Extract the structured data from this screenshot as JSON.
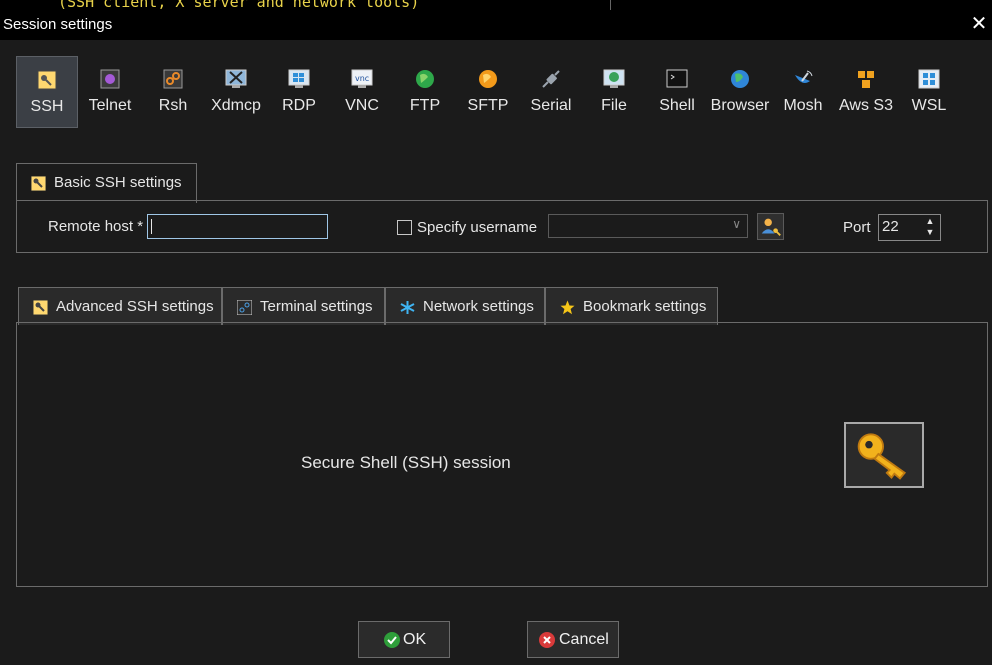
{
  "background": {
    "terminal_text": "(SSH client, X server and network tools)"
  },
  "window": {
    "title": "Session settings",
    "close_glyph": "✕"
  },
  "session_types": [
    {
      "label": "SSH",
      "icon": "ssh-key-icon"
    },
    {
      "label": "Telnet",
      "icon": "telnet-icon"
    },
    {
      "label": "Rsh",
      "icon": "rsh-icon"
    },
    {
      "label": "Xdmcp",
      "icon": "xdmcp-icon"
    },
    {
      "label": "RDP",
      "icon": "rdp-icon"
    },
    {
      "label": "VNC",
      "icon": "vnc-icon"
    },
    {
      "label": "FTP",
      "icon": "ftp-globe-icon"
    },
    {
      "label": "SFTP",
      "icon": "sftp-globe-icon"
    },
    {
      "label": "Serial",
      "icon": "serial-plug-icon"
    },
    {
      "label": "File",
      "icon": "file-monitor-icon"
    },
    {
      "label": "Shell",
      "icon": "shell-terminal-icon"
    },
    {
      "label": "Browser",
      "icon": "browser-globe-icon"
    },
    {
      "label": "Mosh",
      "icon": "mosh-satellite-icon"
    },
    {
      "label": "Aws S3",
      "icon": "aws-s3-cubes-icon"
    },
    {
      "label": "WSL",
      "icon": "wsl-windows-icon"
    }
  ],
  "basic": {
    "tab_label": "Basic SSH settings",
    "remote_host_label": "Remote host *",
    "remote_host_value": "",
    "specify_username_label": "Specify username",
    "specify_username_checked": false,
    "username_value": "",
    "port_label": "Port",
    "port_value": "22"
  },
  "advanced_tabs": [
    {
      "label": "Advanced SSH settings",
      "icon": "ssh-key-icon"
    },
    {
      "label": "Terminal settings",
      "icon": "terminal-icon"
    },
    {
      "label": "Network settings",
      "icon": "network-icon"
    },
    {
      "label": "Bookmark settings",
      "icon": "star-icon"
    }
  ],
  "description": "Secure Shell (SSH) session",
  "buttons": {
    "ok": "OK",
    "cancel": "Cancel"
  },
  "colors": {
    "accent": "#e9a31f",
    "ok": "#2e9e3a",
    "cancel": "#d93a3a"
  }
}
